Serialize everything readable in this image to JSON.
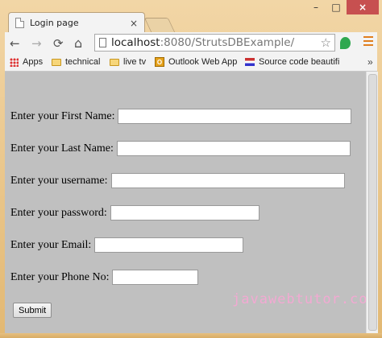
{
  "browser": {
    "tab_title": "Login page",
    "tab_close": "×",
    "window_controls": {
      "minimize": "–",
      "maximize": "□",
      "close": "×"
    },
    "nav": {
      "back": "←",
      "forward": "→",
      "reload": "⟳",
      "home": "⌂"
    },
    "url_host": "localhost",
    "url_rest": ":8080/StrutsDBExample/",
    "star": "☆",
    "bookmarks": [
      {
        "label": "Apps",
        "icon": "apps-grid-icon"
      },
      {
        "label": "technical",
        "icon": "folder-icon"
      },
      {
        "label": "live tv",
        "icon": "folder-icon"
      },
      {
        "label": "Outlook Web App",
        "icon": "outlook-icon"
      },
      {
        "label": "Source code beautifi",
        "icon": "flag-icon"
      }
    ],
    "bookmarks_more": "»",
    "accent": "#e07f1f"
  },
  "form": {
    "first_name_label": "Enter your First Name:",
    "first_name_value": "",
    "last_name_label": "Enter your Last Name:",
    "last_name_value": "",
    "username_label": "Enter your username:",
    "username_value": "",
    "password_label": "Enter your password:",
    "password_value": "",
    "email_label": "Enter your Email:",
    "email_value": "",
    "phone_label": "Enter your Phone No:",
    "phone_value": "",
    "submit_label": "Submit"
  },
  "watermark": "javawebtutor.com",
  "colors": {
    "content_bg": "#c0c0c0",
    "frame": "#e8c48a",
    "close_button": "#c75050"
  }
}
